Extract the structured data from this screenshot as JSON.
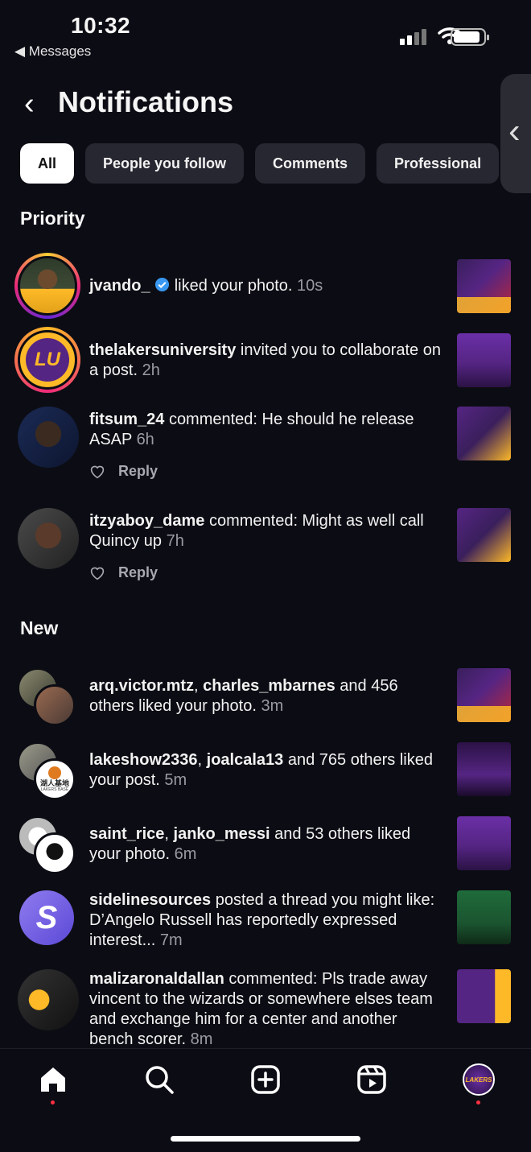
{
  "status_bar": {
    "time": "10:32",
    "back_app": "Messages"
  },
  "header": {
    "title": "Notifications"
  },
  "tabs": [
    {
      "label": "All",
      "active": true
    },
    {
      "label": "People you follow",
      "active": false
    },
    {
      "label": "Comments",
      "active": false
    },
    {
      "label": "Professional",
      "active": false
    }
  ],
  "sections": {
    "priority": "Priority",
    "new": "New"
  },
  "priority": [
    {
      "user": "jvando_",
      "verified": true,
      "action": "liked your photo.",
      "time": "10s"
    },
    {
      "user": "thelakersuniversity",
      "action": "invited you to collaborate on a post.",
      "time": "2h"
    },
    {
      "user": "fitsum_24",
      "action": "commented: He should he release ASAP",
      "time": "6h",
      "reply": "Reply"
    },
    {
      "user": "itzyaboy_dame",
      "action": "commented: Might as well call Quincy up",
      "time": "7h",
      "reply": "Reply"
    }
  ],
  "new": [
    {
      "user": "arq.victor.mtz",
      "sep": ", ",
      "user2": "charles_mbarnes",
      "action": "and 456 others liked your photo.",
      "time": "3m"
    },
    {
      "user": "lakeshow2336",
      "sep": ", ",
      "user2": "joalcala13",
      "action": "and 765 others liked your post.",
      "time": "5m"
    },
    {
      "user": "saint_rice",
      "sep": ", ",
      "user2": "janko_messi",
      "action": "and 53 others liked your photo.",
      "time": "6m"
    },
    {
      "user": "sidelinesources",
      "action": "posted a thread you might like: D’Angelo Russell has reportedly expressed interest...",
      "time": "7m"
    },
    {
      "user": "malizaronaldallan",
      "action": "commented: Pls trade away vincent to the wizards or somewhere elses team and exchange him for a center and another bench scorer.",
      "time": "8m"
    }
  ],
  "avatar_text": {
    "lu": "LU",
    "lakers_base": "湖人基地",
    "lakers_base_sub": "LAKERS BASE",
    "threads": "S",
    "profile": "LAKERS"
  },
  "colors": {
    "background": "#0c0d14",
    "tab_bg": "#262730",
    "accent_verified": "#3897f0",
    "notification_dot": "#ff3040",
    "lakers_purple": "#552583",
    "lakers_gold": "#fdb927"
  },
  "nav": [
    "home-icon",
    "search-icon",
    "create-icon",
    "reels-icon",
    "profile-avatar"
  ]
}
